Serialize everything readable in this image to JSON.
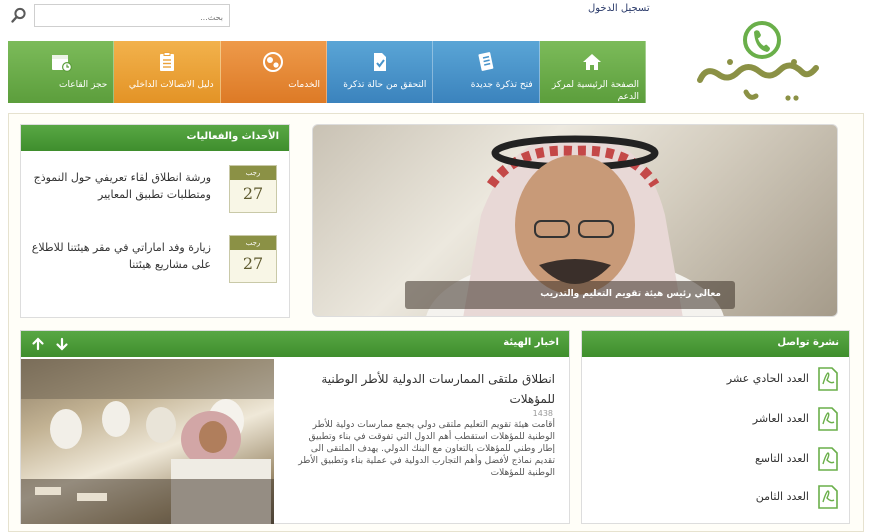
{
  "header": {
    "login_label": "تسجيل الدخول",
    "search_placeholder": "بحث..."
  },
  "nav": {
    "tiles": [
      {
        "label": "الصفحة الرئيسية لمركز الدعم",
        "icon": "home-icon"
      },
      {
        "label": "فتح تذكرة جديدة",
        "icon": "ticket-icon"
      },
      {
        "label": "التحقق من حالة تذكرة",
        "icon": "document-check-icon"
      },
      {
        "label": "الخدمات",
        "icon": "services-icon"
      },
      {
        "label": "دليل الاتصالات الداخلي",
        "icon": "directory-icon"
      },
      {
        "label": "حجز القاعات",
        "icon": "calendar-icon"
      }
    ],
    "colors": [
      "#6aaf4a",
      "#4894cb",
      "#4894cb",
      "#e5883a",
      "#eaa23b",
      "#6aaf4a"
    ]
  },
  "slider": {
    "caption": "معالي رئيس هيئة تقويم التعليم والتدريب"
  },
  "events": {
    "title": "الأحداث والفعاليات",
    "items": [
      {
        "month": "رجب",
        "day": "27",
        "text": "ورشة انطلاق لقاء تعريفي حول النموذج ومتطلبات تطبيق المعايير"
      },
      {
        "month": "رجب",
        "day": "27",
        "text": "زيارة وفد اماراتي في مقر هيئتنا للاطلاع على مشاريع هيئتنا"
      }
    ]
  },
  "news": {
    "title": "اخبار الهيئة",
    "headline": "انطلاق ملتقى الممارسات الدولية للأطر الوطنية للمؤهلات",
    "date": "1438",
    "body": "أقامت هيئة تقويم التعليم ملتقى دولي يجمع ممارسات دولية للأطر الوطنية للمؤهلات استقطب أهم الدول التي تفوقت في بناء وتطبيق إطار وطني للمؤهلات بالتعاون مع البنك الدولي. يهدف الملتقى الى تقديم نماذج لأفضل وأهم التجارب الدولية في عملية بناء وتطبيق الأطر الوطنية للمؤهلات"
  },
  "newsletter": {
    "title": "نشرة تواصل",
    "issues": [
      "العدد الحادي عشر",
      "العدد العاشر",
      "العدد التاسع",
      "العدد الثامن"
    ]
  },
  "brand": {
    "logo_text": "خدمتي",
    "green": "#5ea43f",
    "olive": "#8b9145"
  }
}
